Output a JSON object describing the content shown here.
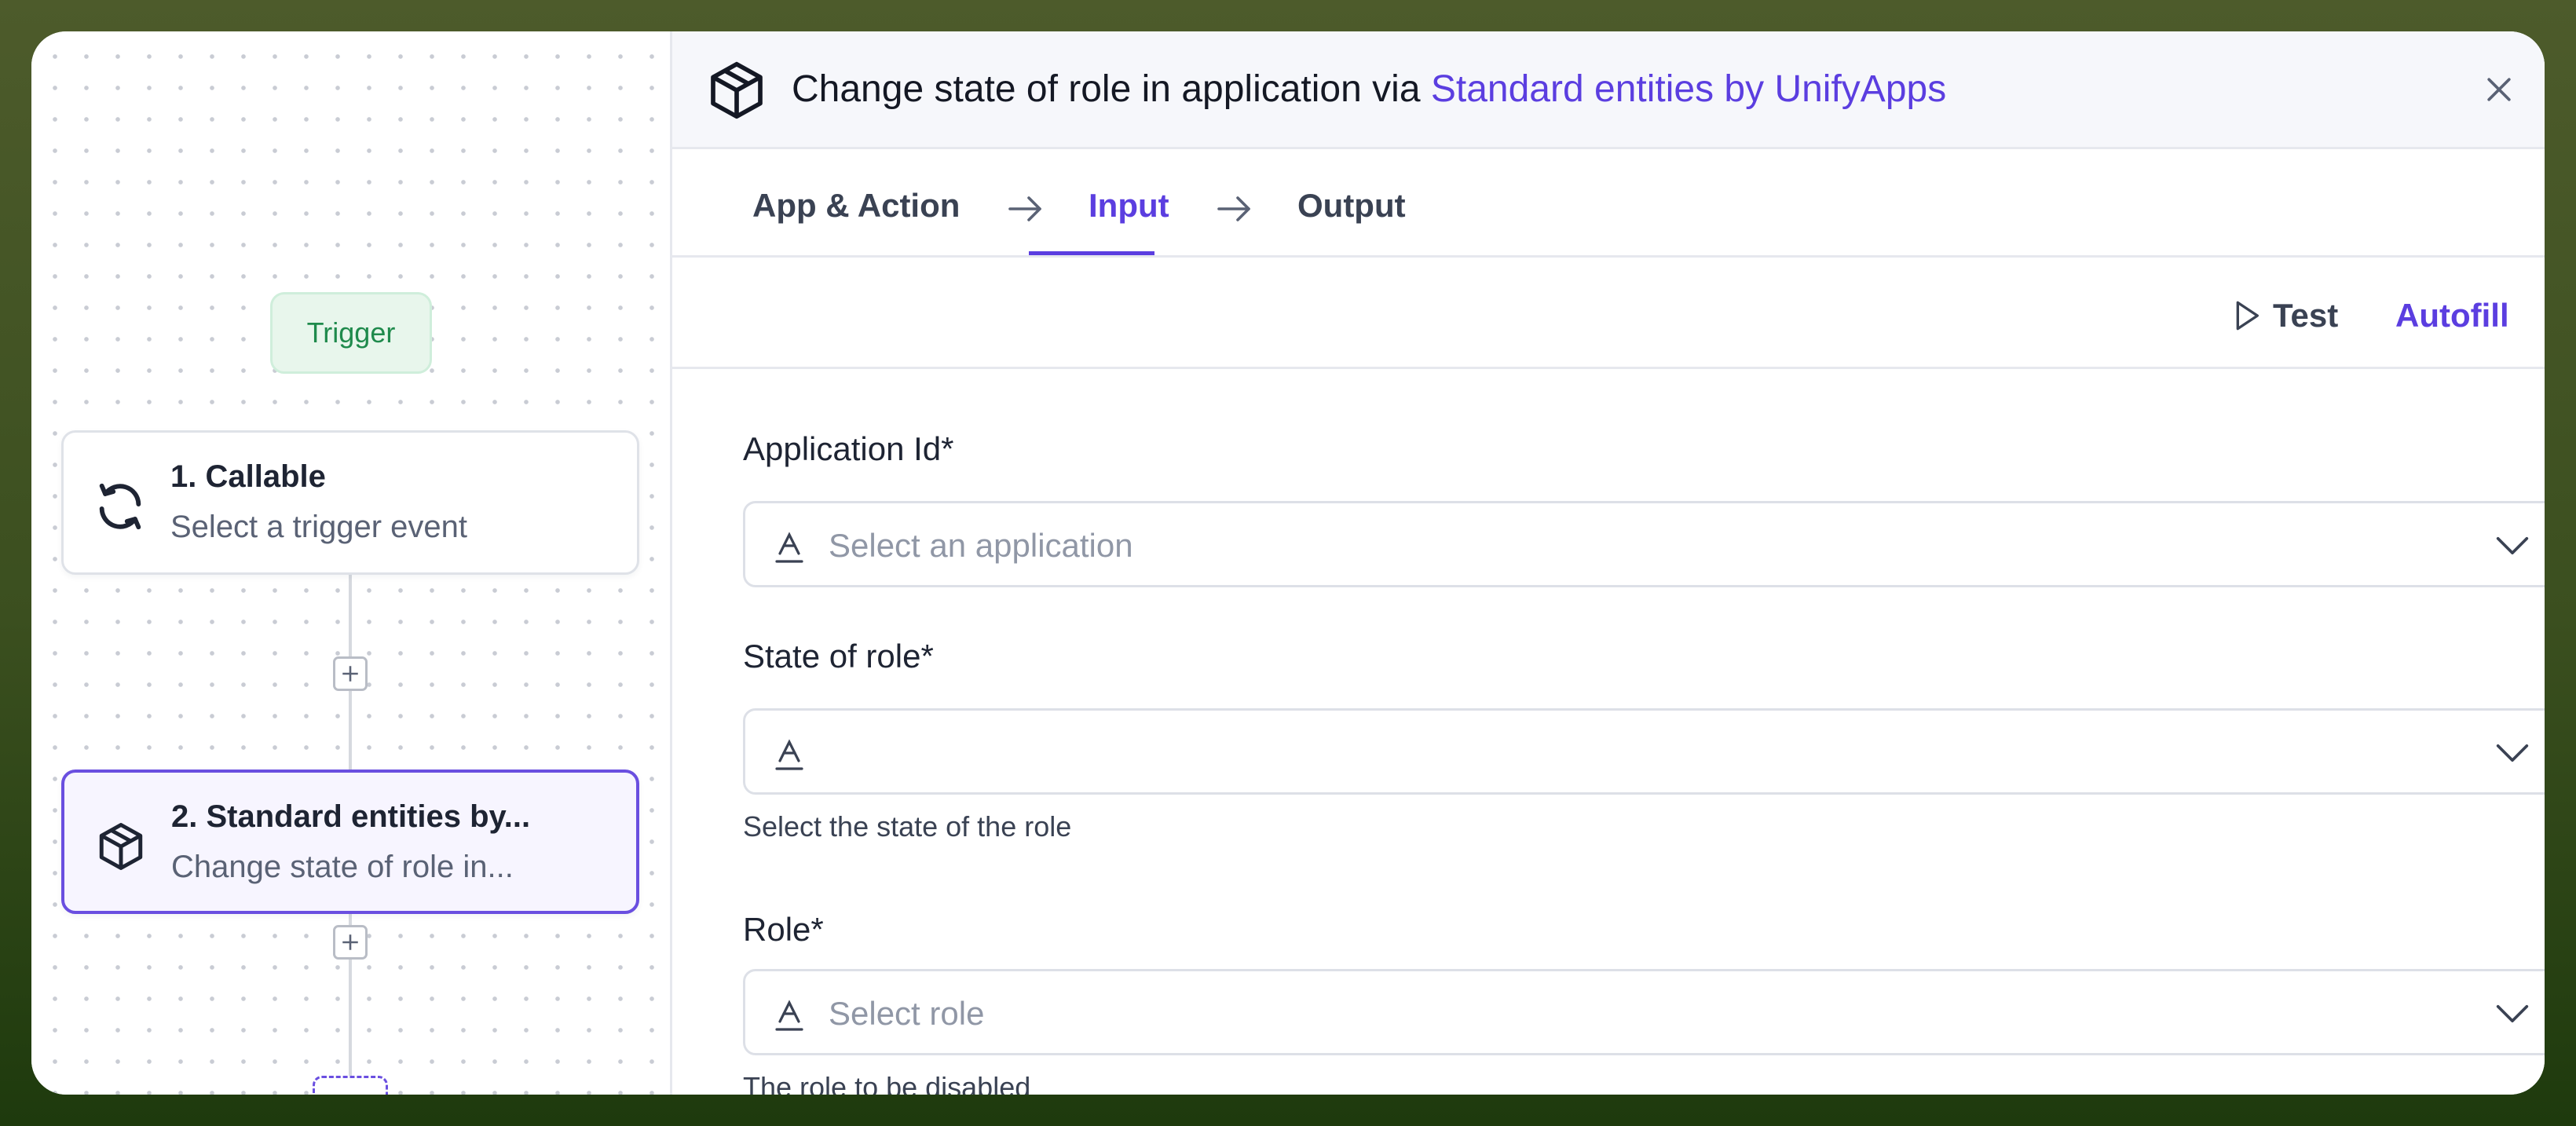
{
  "canvas": {
    "trigger_badge": "Trigger",
    "nodes": [
      {
        "title": "1. Callable",
        "subtitle": "Select a trigger event",
        "icon": "refresh-icon"
      },
      {
        "title": "2. Standard entities by...",
        "subtitle": "Change state of role in...",
        "icon": "package-icon"
      }
    ]
  },
  "header": {
    "title_prefix": "Change state of role in application via ",
    "title_link": "Standard entities by UnifyApps",
    "icon": "package-icon",
    "close_icon": "close-icon"
  },
  "tabs": [
    {
      "label": "App & Action",
      "active": false
    },
    {
      "label": "Input",
      "active": true
    },
    {
      "label": "Output",
      "active": false
    }
  ],
  "toolbar": {
    "test_label": "Test",
    "autofill_label": "Autofill"
  },
  "form": {
    "fields": [
      {
        "label": "Application Id*",
        "placeholder": "Select an application",
        "helper": ""
      },
      {
        "label": "State of role*",
        "placeholder": "",
        "helper": "Select the state of the role"
      },
      {
        "label": "Role*",
        "placeholder": "Select role",
        "helper": "The role to be disabled"
      }
    ]
  },
  "colors": {
    "accent": "#5b3ee0",
    "trigger_green": "#1f8a4c",
    "background_outer": "#3b4f1f"
  }
}
